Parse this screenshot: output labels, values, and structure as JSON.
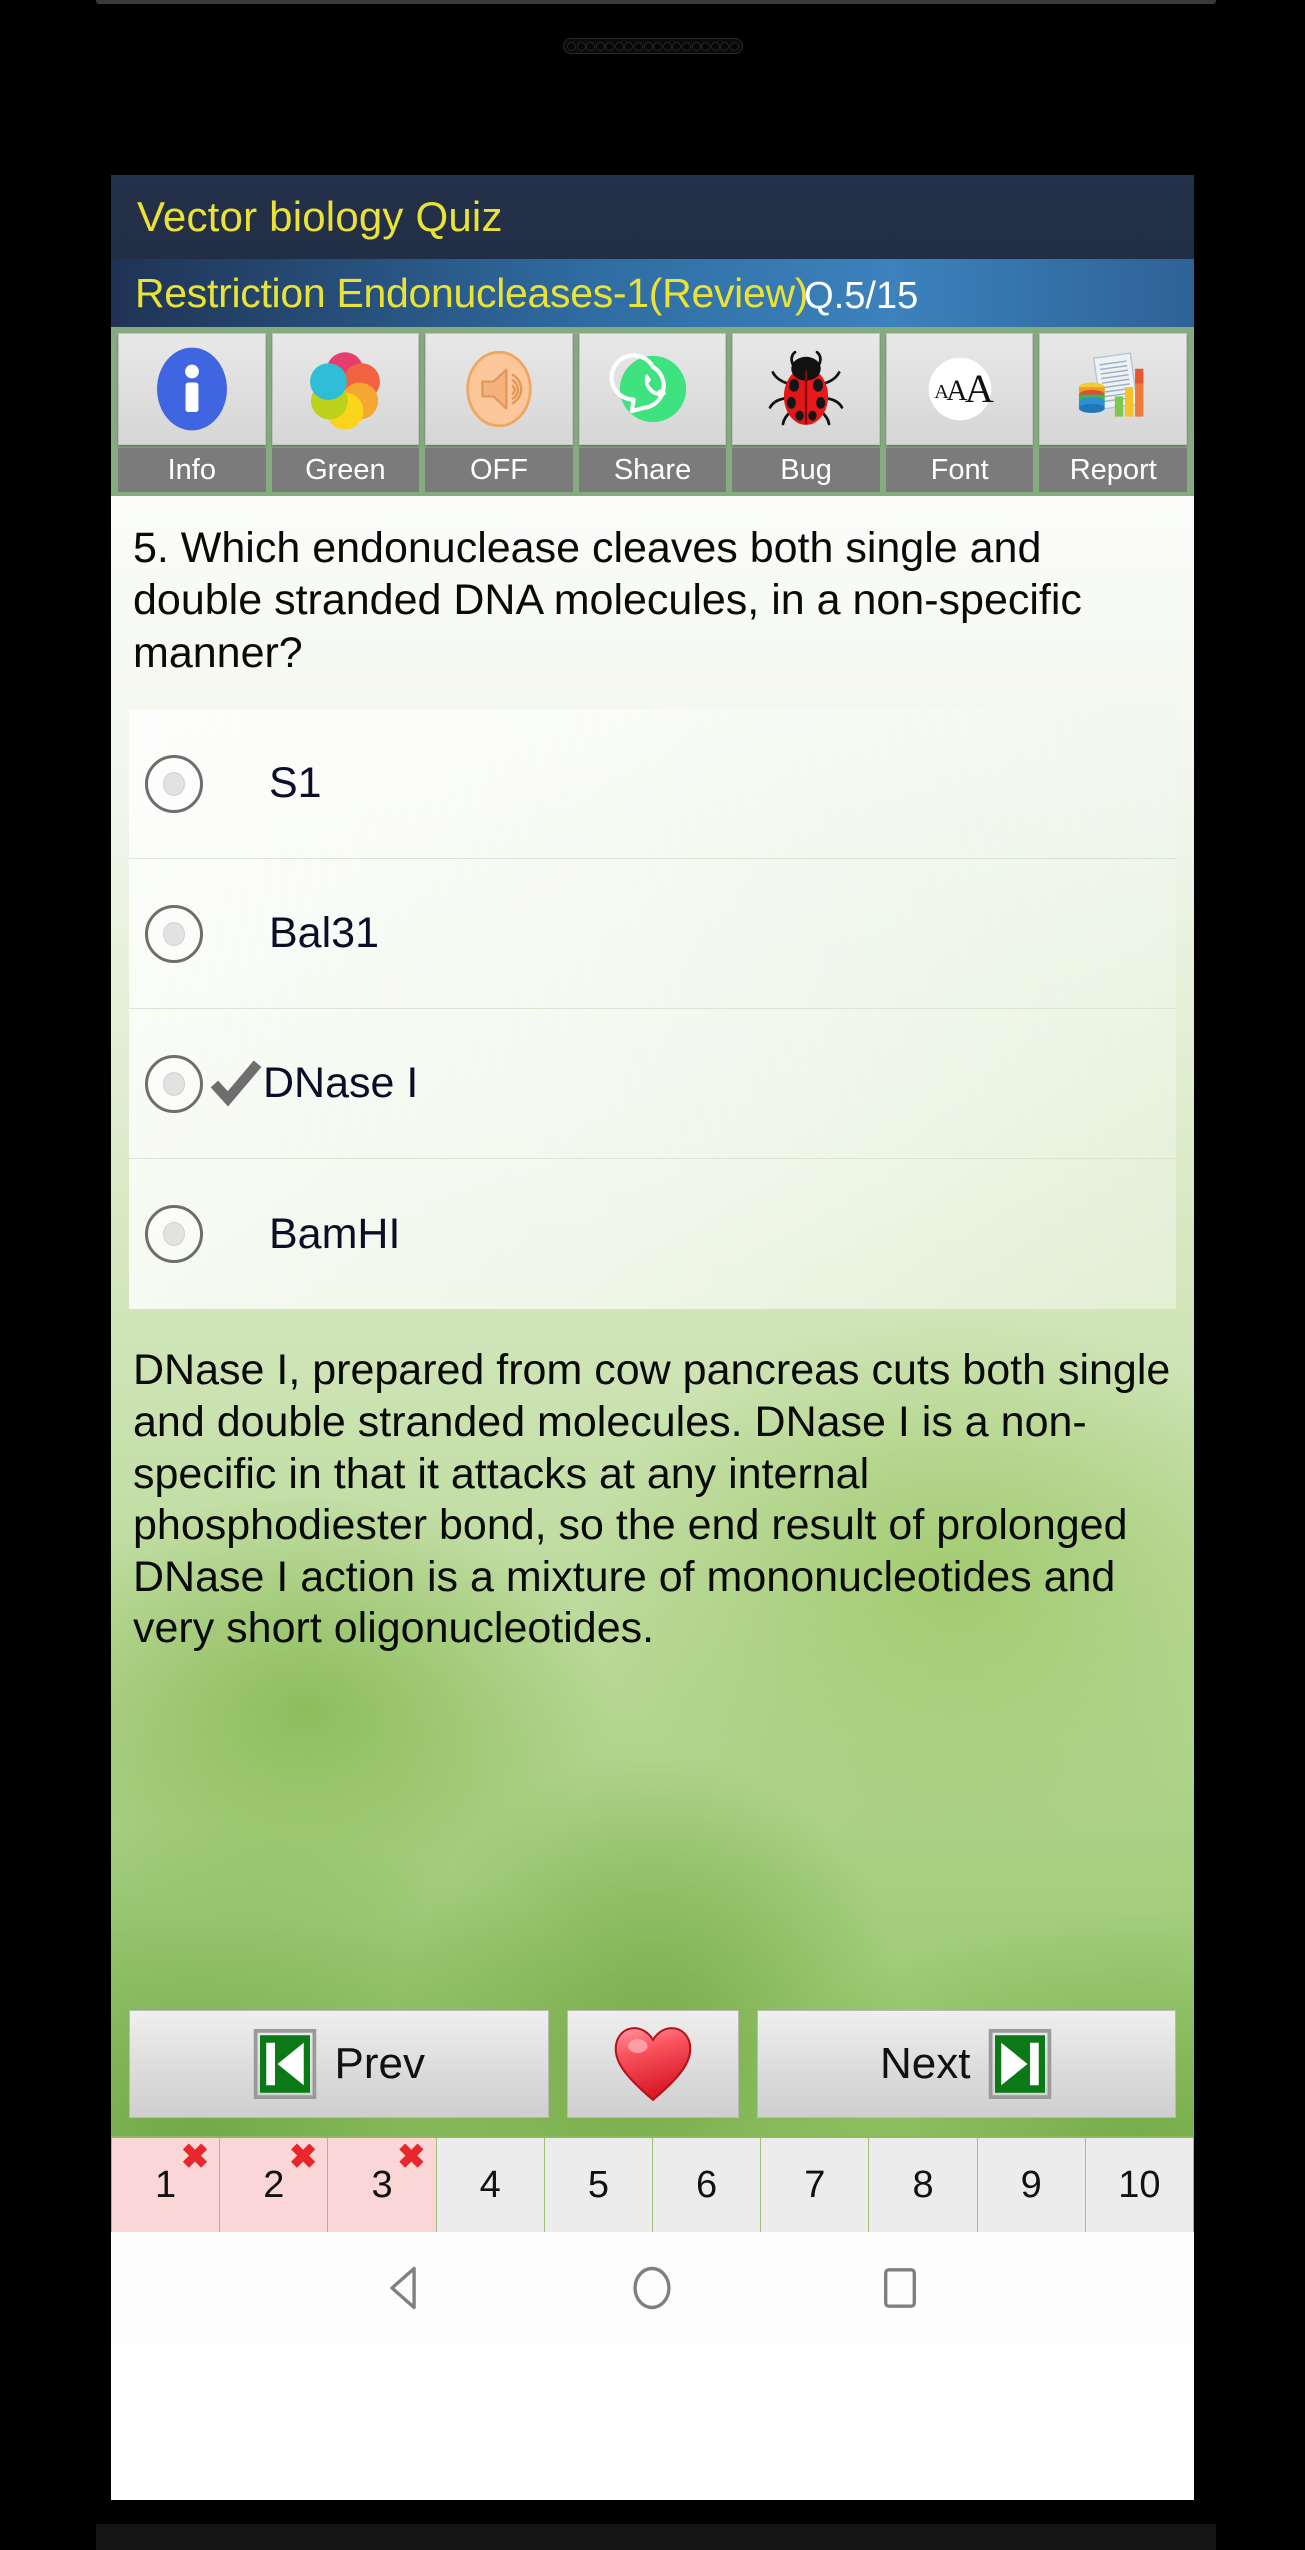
{
  "app": {
    "title": "Vector biology Quiz",
    "subtitle": "Restriction Endonucleases-1(Review)",
    "question_counter": "Q.5/15",
    "title_color": "#eae234",
    "titlebar_color": "#25314a",
    "subtitlebar_color": "#3c82bd"
  },
  "toolbar": {
    "items": [
      {
        "label": "Info",
        "icon": "info-icon"
      },
      {
        "label": "Green",
        "icon": "color-palette-icon"
      },
      {
        "label": "OFF",
        "icon": "speaker-sound-icon"
      },
      {
        "label": "Share",
        "icon": "whatsapp-share-icon"
      },
      {
        "label": "Bug",
        "icon": "ladybug-icon"
      },
      {
        "label": "Font",
        "icon": "font-size-icon"
      },
      {
        "label": "Report",
        "icon": "report-chart-icon"
      }
    ]
  },
  "question": {
    "text": "5. Which endonuclease cleaves both single and double stranded DNA molecules, in a non-specific manner?",
    "number": 5,
    "options": [
      {
        "label": "S1",
        "selected": false,
        "correct": false
      },
      {
        "label": "Bal31",
        "selected": false,
        "correct": false
      },
      {
        "label": "DNase I",
        "selected": false,
        "correct": true
      },
      {
        "label": "BamHI",
        "selected": false,
        "correct": false
      }
    ],
    "explanation": "DNase I, prepared from cow pancreas cuts both single and double stranded molecules. DNase I is a non-specific in that it attacks at any internal phosphodiester bond, so the end result of prolonged DNase I action is a mixture of mononucleotides and very short oligonucleotides."
  },
  "navigation": {
    "prev_label": "Prev",
    "next_label": "Next",
    "prev_icon": "skip-previous-icon",
    "next_icon": "skip-next-icon",
    "favorite_icon": "heart-icon"
  },
  "question_strip": {
    "items": [
      {
        "number": "1",
        "status": "wrong",
        "mark": "✖"
      },
      {
        "number": "2",
        "status": "wrong",
        "mark": "✖"
      },
      {
        "number": "3",
        "status": "wrong",
        "mark": "✖"
      },
      {
        "number": "4",
        "status": "neutral",
        "mark": ""
      },
      {
        "number": "5",
        "status": "neutral",
        "mark": ""
      },
      {
        "number": "6",
        "status": "neutral",
        "mark": ""
      },
      {
        "number": "7",
        "status": "neutral",
        "mark": ""
      },
      {
        "number": "8",
        "status": "neutral",
        "mark": ""
      },
      {
        "number": "9",
        "status": "neutral",
        "mark": ""
      },
      {
        "number": "10",
        "status": "neutral",
        "mark": ""
      }
    ],
    "wrong_color": "#fbd6d6",
    "mark_color": "#e8262c"
  },
  "system_nav": {
    "back": "back-triangle-icon",
    "home": "home-circle-icon",
    "recents": "recents-square-icon"
  }
}
